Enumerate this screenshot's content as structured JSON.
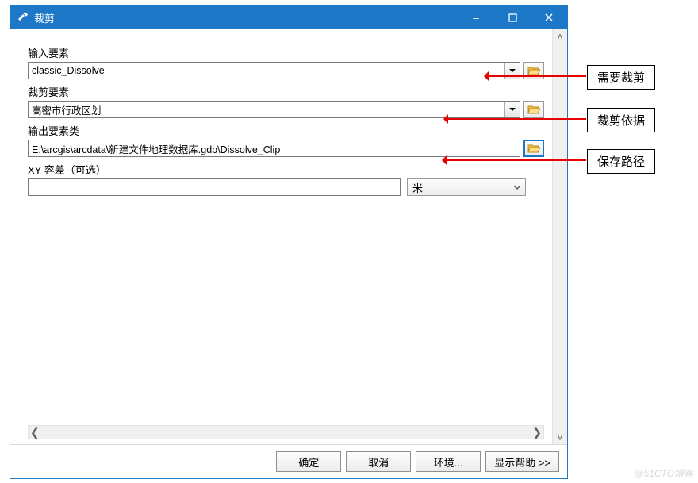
{
  "window": {
    "title": "裁剪",
    "buttons": {
      "min": "–",
      "max": "□",
      "close": "×"
    }
  },
  "fields": {
    "input_features": {
      "label": "输入要素",
      "value": "classic_Dissolve"
    },
    "clip_features": {
      "label": "裁剪要素",
      "value": "高密市行政区划"
    },
    "output_features": {
      "label": "输出要素类",
      "value": "E:\\arcgis\\arcdata\\新建文件地理数据库.gdb\\Dissolve_Clip"
    },
    "xy_tolerance": {
      "label": "XY 容差（可选）",
      "value": "",
      "unit": "米"
    }
  },
  "buttons": {
    "ok": "确定",
    "cancel": "取消",
    "env": "环境...",
    "help": "显示帮助 >>"
  },
  "annotations": {
    "a1": "需要裁剪",
    "a2": "裁剪依据",
    "a3": "保存路径"
  },
  "watermark": "@51CTO博客"
}
